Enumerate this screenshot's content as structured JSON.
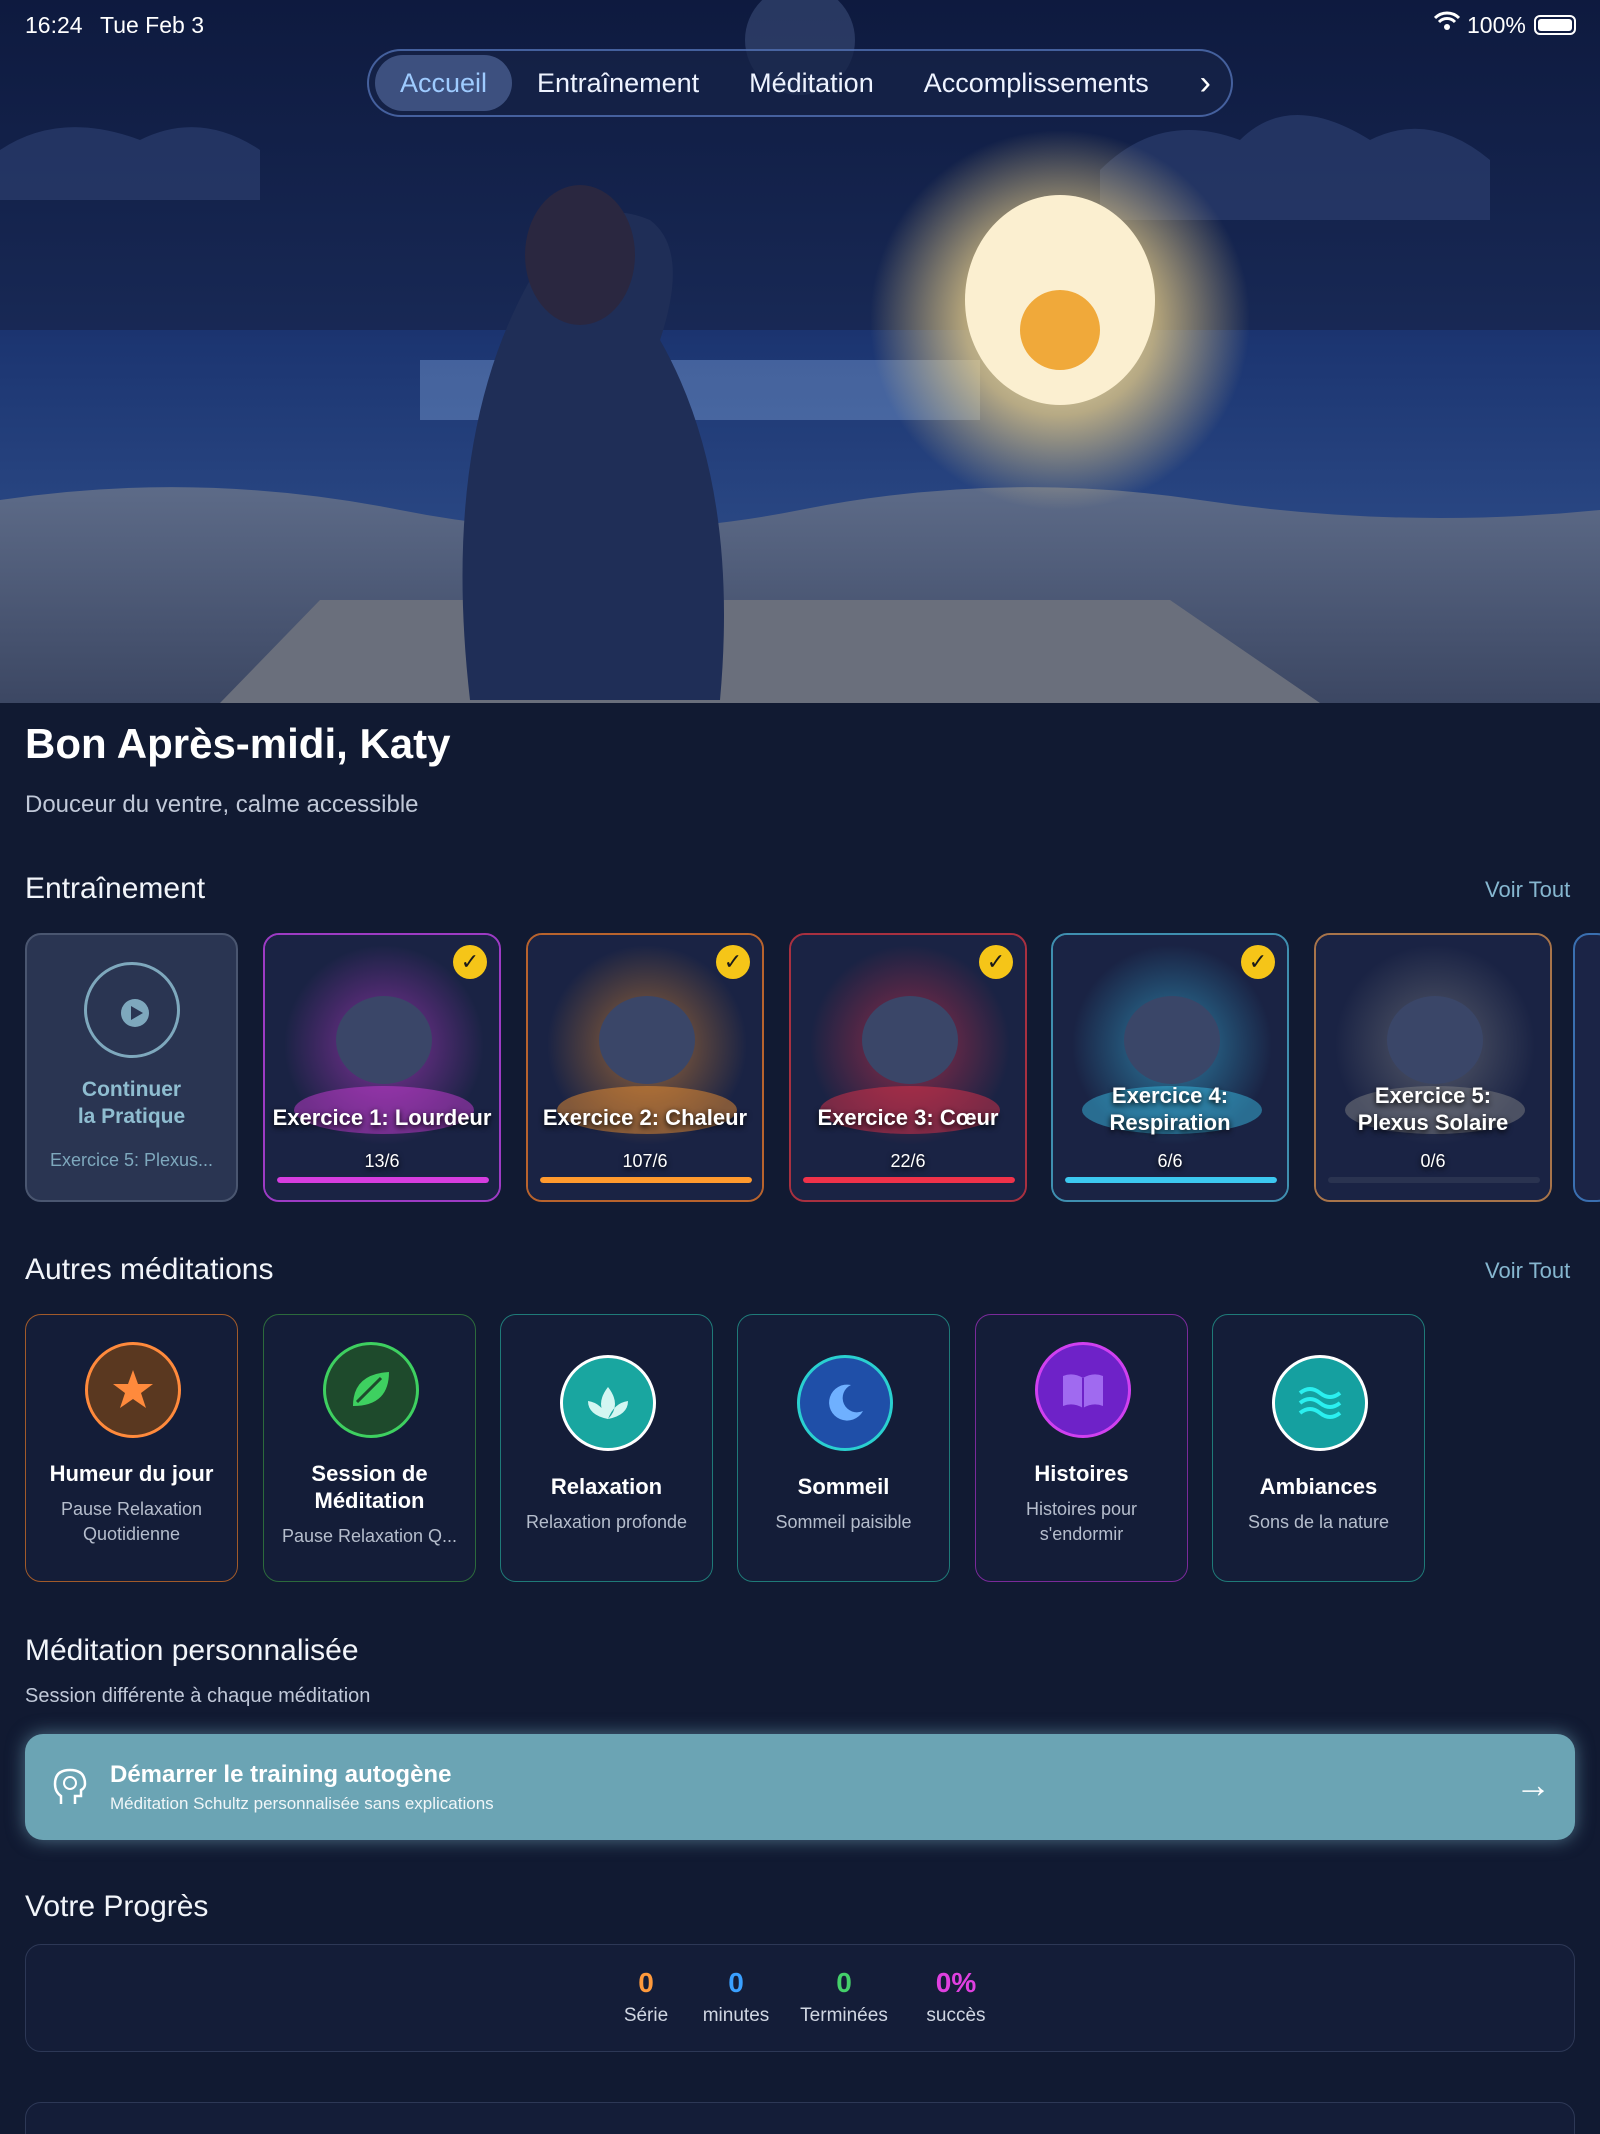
{
  "status": {
    "time": "16:24",
    "date": "Tue Feb 3",
    "battery": "100%",
    "icons": [
      "wifi-icon",
      "battery-icon"
    ]
  },
  "tabs": [
    "Accueil",
    "Entraînement",
    "Méditation",
    "Accomplissements"
  ],
  "greeting": {
    "title": "Bon Après-midi, Katy",
    "subtitle": "Douceur du ventre, calme accessible"
  },
  "training": {
    "heading": "Entraînement",
    "see_all": "Voir Tout",
    "continue": {
      "l1": "Continuer",
      "l2": "la Pratique",
      "sub": "Exercice 5: Plexus..."
    },
    "exercises": [
      {
        "t1": "Exercice 1: Lourdeur",
        "t2": "",
        "count": "13/6",
        "progress": 1.0,
        "color": "#d63de0",
        "border": "#9d3bc4",
        "done": true
      },
      {
        "t1": "Exercice 2: Chaleur",
        "t2": "",
        "count": "107/6",
        "progress": 1.0,
        "color": "#ff9a2e",
        "border": "#b8632d",
        "done": true
      },
      {
        "t1": "Exercice 3: Cœur",
        "t2": "",
        "count": "22/6",
        "progress": 1.0,
        "color": "#f0324a",
        "border": "#a83040",
        "done": true
      },
      {
        "t1": "Exercice 4:",
        "t2": "Respiration",
        "count": "6/6",
        "progress": 1.0,
        "color": "#3cc8f0",
        "border": "#3f8fb0",
        "done": true
      },
      {
        "t1": "Exercice 5:",
        "t2": "Plexus Solaire",
        "count": "0/6",
        "progress": 0.0,
        "color": "#8a8a8a",
        "border": "#a8744a",
        "done": false
      }
    ]
  },
  "others": {
    "heading": "Autres méditations",
    "see_all": "Voir Tout",
    "items": [
      {
        "icon": "star-icon",
        "title1": "Humeur du jour",
        "title2": "",
        "d1": "Pause Relaxation",
        "d2": "Quotidienne"
      },
      {
        "icon": "leaf-icon",
        "title1": "Session de",
        "title2": "Méditation",
        "d1": "Pause Relaxation Q...",
        "d2": ""
      },
      {
        "icon": "lotus-icon",
        "title1": "Relaxation",
        "title2": "",
        "d1": "Relaxation profonde",
        "d2": ""
      },
      {
        "icon": "moon-icon",
        "title1": "Sommeil",
        "title2": "",
        "d1": "Sommeil paisible",
        "d2": ""
      },
      {
        "icon": "book-icon",
        "title1": "Histoires",
        "title2": "",
        "d1": "Histoires pour",
        "d2": "s'endormir"
      },
      {
        "icon": "waves-icon",
        "title1": "Ambiances",
        "title2": "",
        "d1": "Sons de la nature",
        "d2": ""
      }
    ]
  },
  "custom": {
    "heading": "Méditation personnalisée",
    "sub": "Session différente à chaque méditation",
    "cta_title": "Démarrer le training autogène",
    "cta_sub": "Méditation Schultz personnalisée sans explications"
  },
  "progress": {
    "heading": "Votre Progrès",
    "stats": [
      {
        "value": "0",
        "label": "Série",
        "color": "#ff9a3c"
      },
      {
        "value": "0",
        "label": "minutes",
        "color": "#3aa0ff"
      },
      {
        "value": "0",
        "label": "Terminées",
        "color": "#44d06a"
      },
      {
        "value": "0%",
        "label": "succès",
        "color": "#e040e0"
      }
    ]
  }
}
